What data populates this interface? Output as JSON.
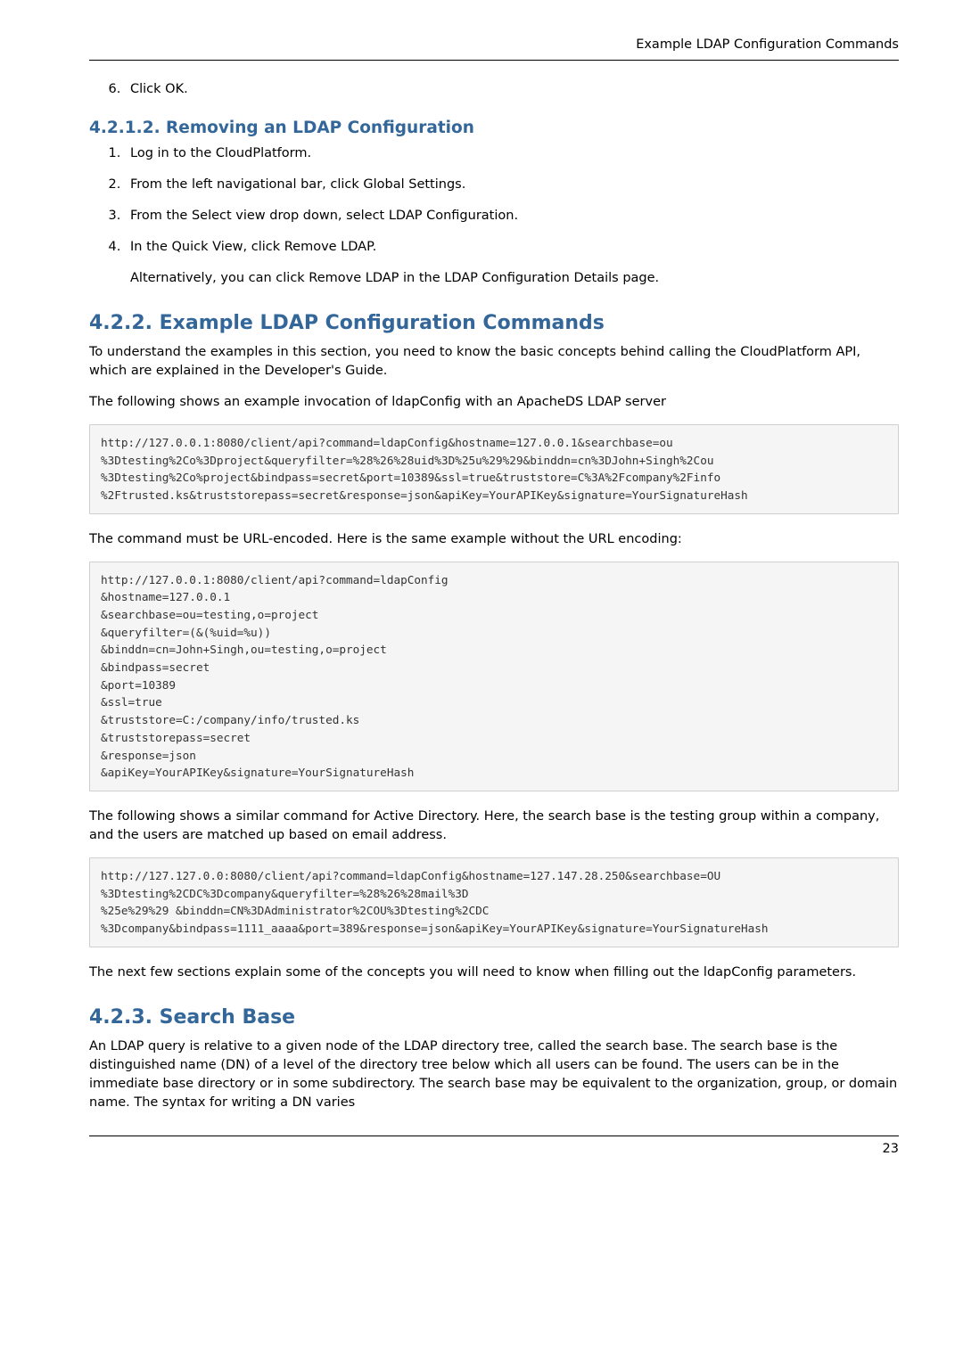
{
  "running_header": "Example LDAP Configuration Commands",
  "page_number": "23",
  "step6": "Click OK.",
  "h_4212": "4.2.1.2. Removing an LDAP Configuration",
  "steps_4212": {
    "s1": "Log in to the CloudPlatform.",
    "s2": "From the left navigational bar, click Global Settings.",
    "s3": "From the Select view drop down, select LDAP Configuration.",
    "s4": "In the Quick View, click Remove LDAP.",
    "s4b": "Alternatively, you can click Remove LDAP in the LDAP Configuration Details page."
  },
  "h_422": "4.2.2. Example LDAP Configuration Commands",
  "p_422a": "To understand the examples in this section, you need to know the basic concepts behind calling the CloudPlatform API, which are explained in the Developer's Guide.",
  "p_422b": "The following shows an example invocation of ldapConfig with an ApacheDS LDAP server",
  "code1": "http://127.0.0.1:8080/client/api?command=ldapConfig&hostname=127.0.0.1&searchbase=ou\n%3Dtesting%2Co%3Dproject&queryfilter=%28%26%28uid%3D%25u%29%29&binddn=cn%3DJohn+Singh%2Cou\n%3Dtesting%2Co%project&bindpass=secret&port=10389&ssl=true&truststore=C%3A%2Fcompany%2Finfo\n%2Ftrusted.ks&truststorepass=secret&response=json&apiKey=YourAPIKey&signature=YourSignatureHash",
  "p_422c": "The command must be URL-encoded. Here is the same example without the URL encoding:",
  "code2": "http://127.0.0.1:8080/client/api?command=ldapConfig\n&hostname=127.0.0.1\n&searchbase=ou=testing,o=project\n&queryfilter=(&(%uid=%u))\n&binddn=cn=John+Singh,ou=testing,o=project\n&bindpass=secret\n&port=10389\n&ssl=true\n&truststore=C:/company/info/trusted.ks\n&truststorepass=secret\n&response=json\n&apiKey=YourAPIKey&signature=YourSignatureHash",
  "p_422d": "The following shows a similar command for Active Directory. Here, the search base is the testing group within a company, and the users are matched up based on email address.",
  "code3": "http://127.127.0.0:8080/client/api?command=ldapConfig&hostname=127.147.28.250&searchbase=OU\n%3Dtesting%2CDC%3Dcompany&queryfilter=%28%26%28mail%3D\n%25e%29%29 &binddn=CN%3DAdministrator%2COU%3Dtesting%2CDC\n%3Dcompany&bindpass=1111_aaaa&port=389&response=json&apiKey=YourAPIKey&signature=YourSignatureHash",
  "p_422e": "The next few sections explain some of the concepts you will need to know when filling out the ldapConfig parameters.",
  "h_423": "4.2.3. Search Base",
  "p_423": "An LDAP query is relative to a given node of the LDAP directory tree, called the search base. The search base is the distinguished name (DN) of a level of the directory tree below which all users can be found. The users can be in the immediate base directory or in some subdirectory. The search base may be equivalent to the organization, group, or domain name. The syntax for writing a DN varies"
}
